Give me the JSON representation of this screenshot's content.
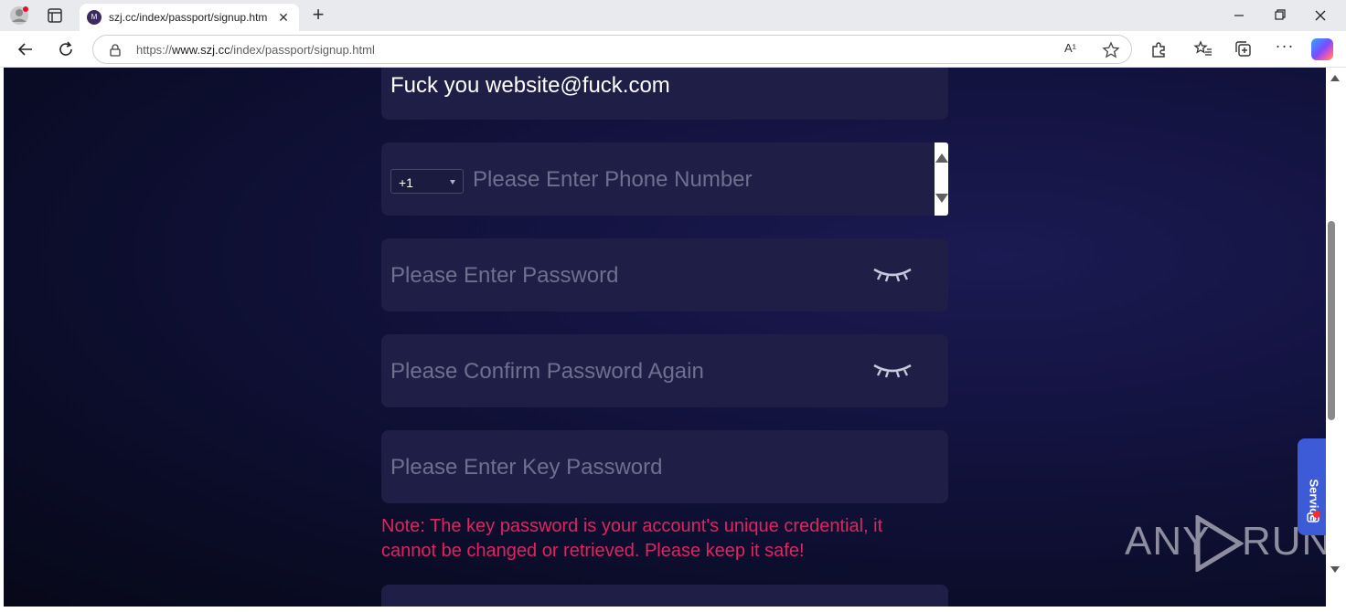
{
  "browser": {
    "tab_title": "szj.cc/index/passport/signup.htm",
    "tab_favicon_letter": "M",
    "url_prefix": "https://",
    "url_host": "www.szj.cc",
    "url_path": "/index/passport/signup.html",
    "read_aloud_label": "A¹"
  },
  "form": {
    "email_value": "Fuck you website@fuck.com",
    "country_code": "+1",
    "phone_placeholder": "Please Enter Phone Number",
    "password_placeholder": "Please Enter Password",
    "confirm_placeholder": "Please Confirm Password Again",
    "key_placeholder": "Please Enter Key Password",
    "note_line1": "Note: The key password is your account's unique credential, it",
    "note_line2": "cannot be changed or retrieved. Please keep it safe!"
  },
  "service_label": "Service",
  "watermark": {
    "left": "ANY",
    "right": "RUN"
  },
  "colors": {
    "background": "#0b0d2a",
    "field": "#1e1e46",
    "note": "#e0245e",
    "service": "#3d5bd6"
  }
}
